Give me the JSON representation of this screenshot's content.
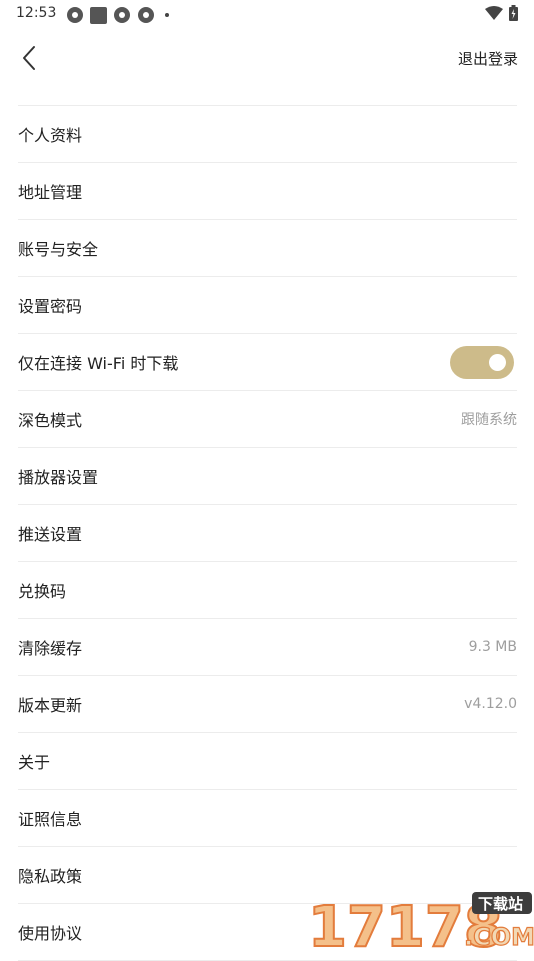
{
  "status_bar": {
    "time": "12:53"
  },
  "header": {
    "logout_label": "退出登录"
  },
  "settings": {
    "items": [
      {
        "label": "个人资料"
      },
      {
        "label": "地址管理"
      },
      {
        "label": "账号与安全"
      },
      {
        "label": "设置密码"
      },
      {
        "label": "仅在连接 Wi-Fi 时下载",
        "toggle_on": true
      },
      {
        "label": "深色模式",
        "value": "跟随系统"
      },
      {
        "label": "播放器设置"
      },
      {
        "label": "推送设置"
      },
      {
        "label": "兑换码"
      },
      {
        "label": "清除缓存",
        "value": "9.3 MB"
      },
      {
        "label": "版本更新",
        "value": "v4.12.0"
      },
      {
        "label": "关于"
      },
      {
        "label": "证照信息"
      },
      {
        "label": "隐私政策"
      },
      {
        "label": "使用协议"
      }
    ]
  },
  "colors": {
    "accent": "#cdbb8a",
    "divider": "#ececec",
    "secondary_text": "#9e9e9e"
  },
  "watermark": {
    "number": "17178",
    "badge": "下载站",
    "domain": ".COM"
  }
}
